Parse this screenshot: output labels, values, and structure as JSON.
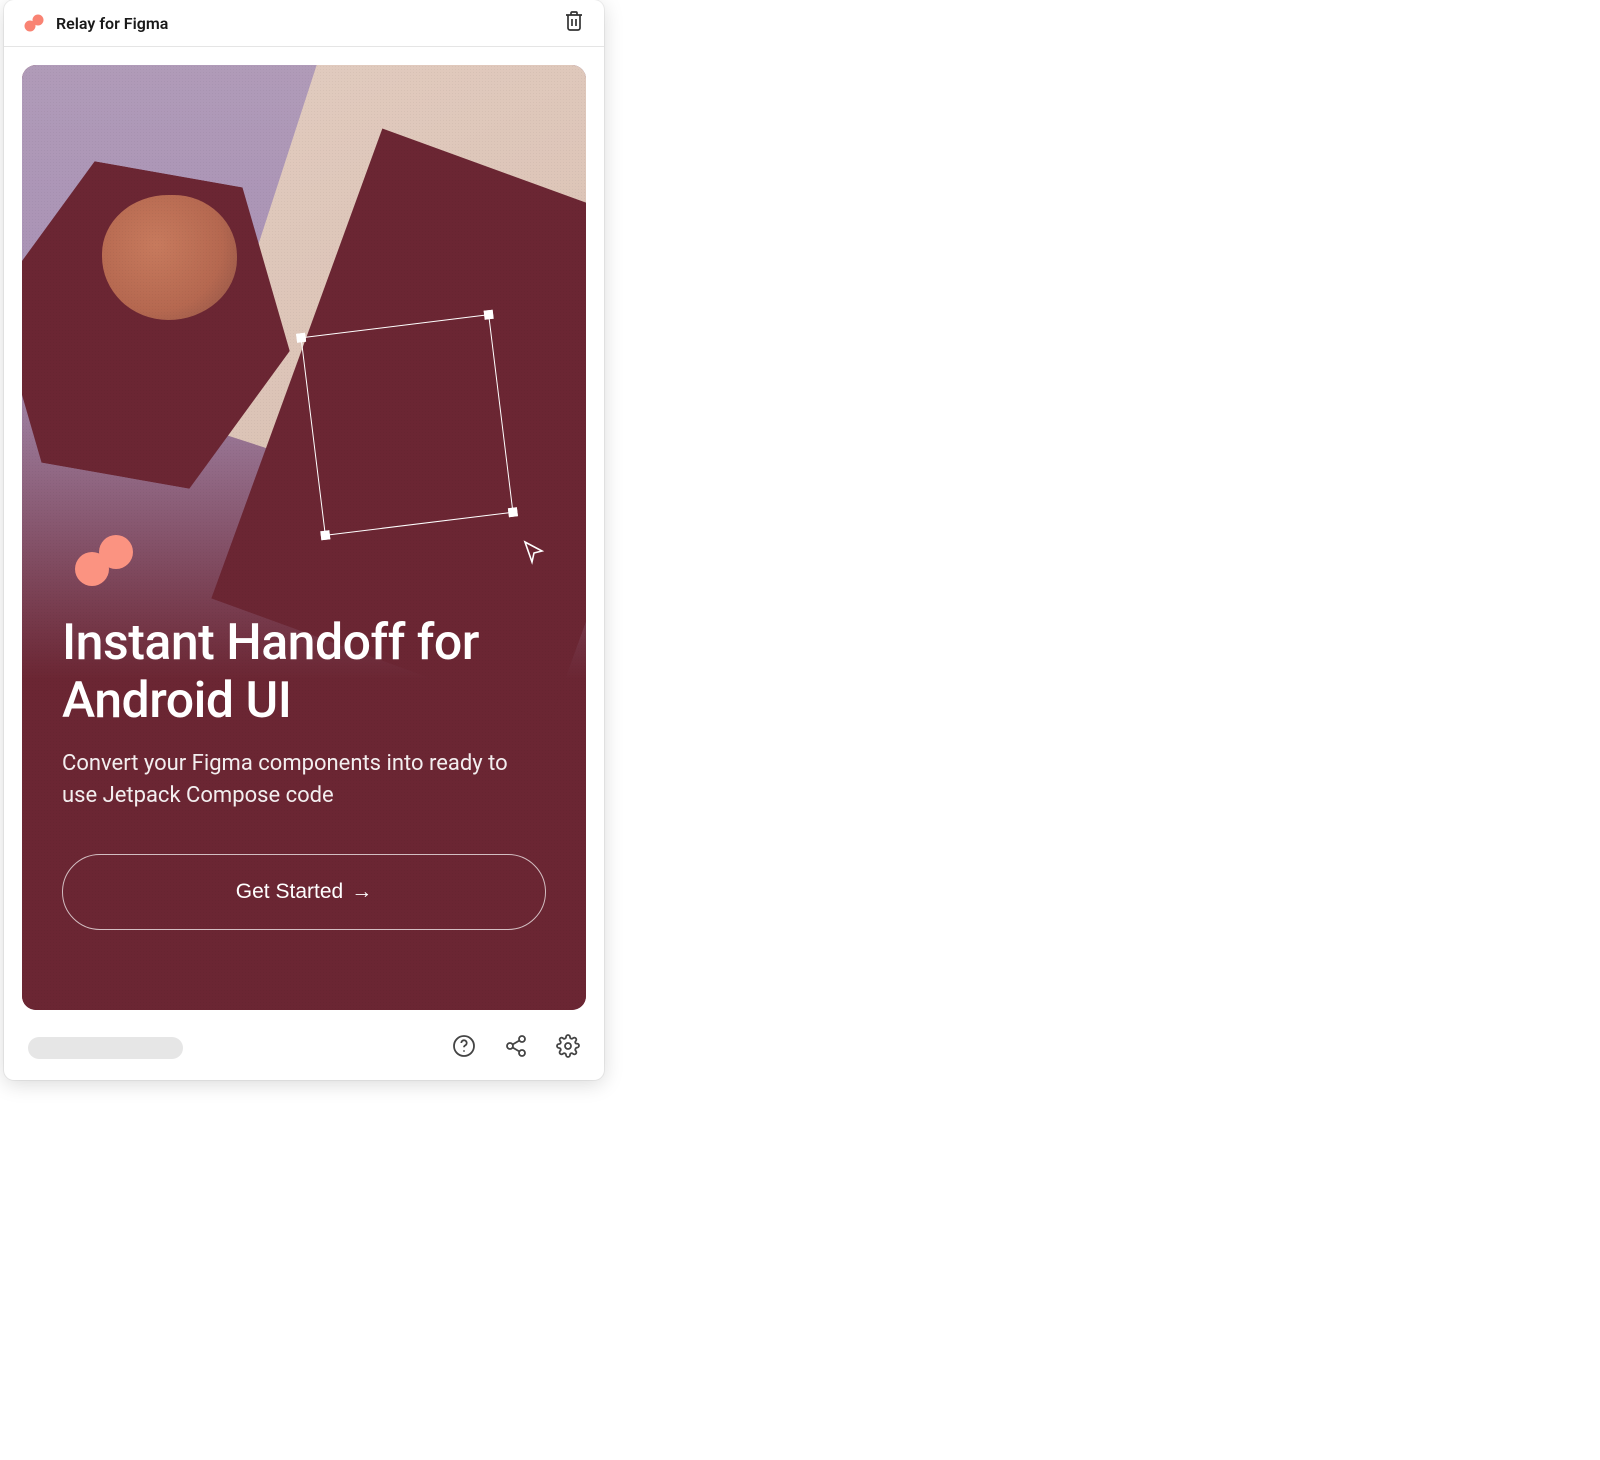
{
  "header": {
    "title": "Relay for Figma",
    "logo_icon": "relay-logo-icon",
    "trash_icon": "trash-icon"
  },
  "hero": {
    "title": "Instant Handoff for Android UI",
    "subtitle": "Convert your Figma components into ready to use Jetpack Compose code",
    "cta_label": "Get Started",
    "cta_arrow": "→",
    "illustration": {
      "shapes": [
        "hexagon",
        "circle",
        "triangle-beige",
        "triangle-maroon"
      ],
      "selection_frame": true,
      "cursor_icon": "cursor-icon",
      "relay_mark_icon": "relay-mark-icon"
    }
  },
  "footer": {
    "icons": [
      "help-circle-icon",
      "share-icon",
      "settings-gear-icon"
    ]
  },
  "colors": {
    "accent_salmon": "#f98373",
    "maroon": "#6b2633",
    "lilac": "#b09bb8",
    "beige": "#d8beb0"
  }
}
